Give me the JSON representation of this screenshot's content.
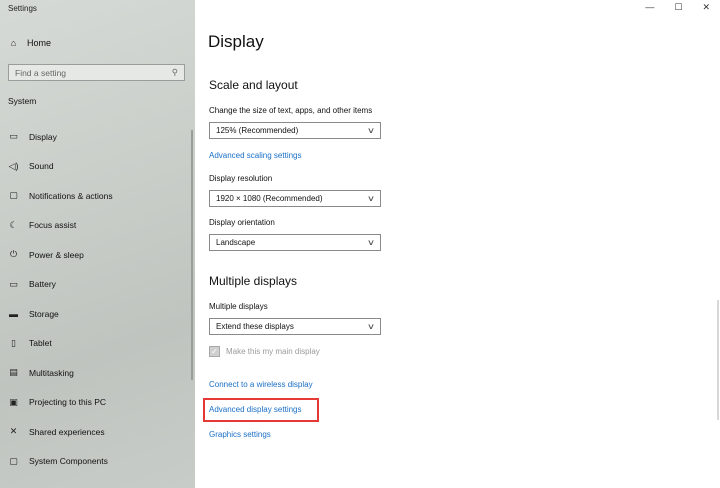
{
  "window": {
    "title": "Settings",
    "controls": [
      "—",
      "☐",
      "✕"
    ]
  },
  "sidebar": {
    "home_label": "Home",
    "search_placeholder": "Find a setting",
    "section": "System",
    "items": [
      {
        "label": "Display",
        "icon": "monitor-icon"
      },
      {
        "label": "Sound",
        "icon": "speaker-icon"
      },
      {
        "label": "Notifications & actions",
        "icon": "notification-icon"
      },
      {
        "label": "Focus assist",
        "icon": "moon-icon"
      },
      {
        "label": "Power & sleep",
        "icon": "power-icon"
      },
      {
        "label": "Battery",
        "icon": "battery-icon"
      },
      {
        "label": "Storage",
        "icon": "storage-icon"
      },
      {
        "label": "Tablet",
        "icon": "tablet-icon"
      },
      {
        "label": "Multitasking",
        "icon": "multitasking-icon"
      },
      {
        "label": "Projecting to this PC",
        "icon": "projecting-icon"
      },
      {
        "label": "Shared experiences",
        "icon": "shared-experiences-icon"
      },
      {
        "label": "System Components",
        "icon": "components-icon"
      }
    ]
  },
  "main": {
    "title": "Display",
    "scale_section": "Scale and layout",
    "scale_label": "Change the size of text, apps, and other items",
    "scale_value": "125% (Recommended)",
    "advanced_scaling": "Advanced scaling settings",
    "resolution_label": "Display resolution",
    "resolution_value": "1920 × 1080 (Recommended)",
    "orientation_label": "Display orientation",
    "orientation_value": "Landscape",
    "multi_section": "Multiple displays",
    "multi_label": "Multiple displays",
    "multi_value": "Extend these displays",
    "main_display_label": "Make this my main display",
    "connect_wireless": "Connect to a wireless display",
    "advanced_display": "Advanced display settings",
    "graphics": "Graphics settings"
  }
}
